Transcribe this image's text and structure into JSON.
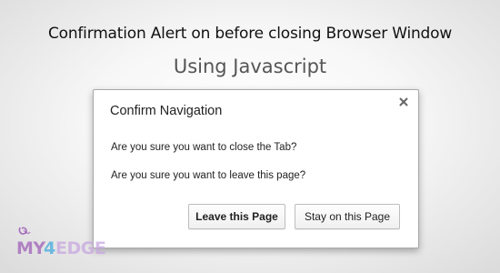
{
  "page": {
    "title": "Confirmation Alert on before closing Browser Window",
    "subtitle": "Using Javascript"
  },
  "dialog": {
    "title": "Confirm Navigation",
    "close_icon": "close-icon",
    "messages": [
      "Are you sure you want to close the Tab?",
      "Are you sure you want to leave this page?"
    ],
    "buttons": {
      "leave_label": "Leave this Page",
      "stay_label": "Stay on this Page"
    }
  },
  "watermark": {
    "brand_text": "MY4EDGE",
    "colors": [
      "#9b59b6",
      "#3aa6dd",
      "#9ccc3a"
    ]
  }
}
